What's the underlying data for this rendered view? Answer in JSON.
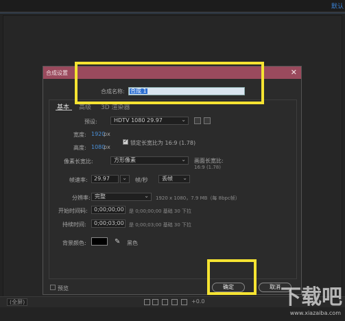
{
  "app": {
    "workspace_label": "默认"
  },
  "bottom_bar": {
    "zoom_label": "(全屏)",
    "offset_label": "+0.0"
  },
  "dialog": {
    "title": "合成设置",
    "close": "✕",
    "name_label": "合成名称:",
    "name_value": "合成 1",
    "tabs": [
      {
        "label": "基本"
      },
      {
        "label": "高级"
      },
      {
        "label": "3D 渲染器"
      }
    ],
    "preset_label": "预设:",
    "preset_value": "HDTV 1080 29.97",
    "width_label": "宽度:",
    "width_value": "1920",
    "width_unit": "px",
    "lock_aspect_label": "锁定长宽比为 16:9 (1.78)",
    "lock_aspect_checked": true,
    "height_label": "高度:",
    "height_value": "1080",
    "height_unit": "px",
    "pixel_aspect_label": "像素长宽比:",
    "pixel_aspect_value": "方形像素",
    "frame_aspect_label": "画面长宽比:",
    "frame_aspect_value": "16:9 (1.78)",
    "frame_rate_label": "帧速率:",
    "frame_rate_value": "29.97",
    "frame_rate_unit": "帧/秒",
    "drop_frame_value": "丢帧",
    "resolution_label": "分辨率:",
    "resolution_value": "完整",
    "resolution_info": "1920 x 1080，7.9 MB（每 8bpc帧）",
    "start_timecode_label": "开始时间码:",
    "start_timecode_value": "0;00;00;00",
    "start_timecode_info": "是 0;00;00;00  基础 30  下拉",
    "duration_label": "持续时间:",
    "duration_value": "0;00;03;00",
    "duration_info": "是 0;00;03;00  基础 30  下拉",
    "bg_color_label": "背景颜色:",
    "bg_color_name": "黑色",
    "bg_color_hex": "#000000",
    "preview_label": "预览",
    "ok_label": "确定",
    "cancel_label": "取消"
  },
  "watermark": {
    "main": "下载吧",
    "sub": "www.xiazaiba.com"
  },
  "colors": {
    "title_bar": "#9a4a5d",
    "highlight": "#f5e332",
    "accent_blue": "#4a90d9"
  }
}
